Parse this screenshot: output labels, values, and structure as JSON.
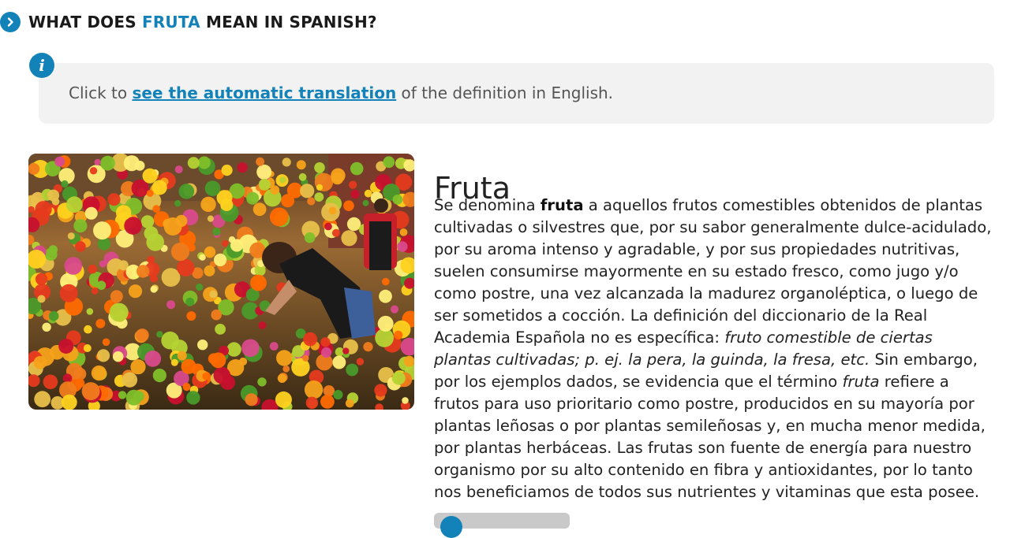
{
  "heading": {
    "prefix": "WHAT DOES ",
    "word": "FRUTA",
    "suffix": " MEAN IN SPANISH?"
  },
  "info": {
    "before": "Click to ",
    "link": "see the automatic translation",
    "after": " of the definition in English."
  },
  "definition": {
    "title": "Fruta",
    "lines": [
      {
        "parts": [
          {
            "t": "Se denomina "
          },
          {
            "b": "fruta"
          },
          {
            "t": " a aquellos frutos comestibles obtenidos de plantas"
          }
        ]
      },
      {
        "parts": [
          {
            "t": "cultivadas o silvestres que, por su sabor generalmente dulce-acidulado,"
          }
        ]
      },
      {
        "parts": [
          {
            "t": "por su aroma intenso y agradable, y por sus propiedades nutritivas,"
          }
        ]
      },
      {
        "parts": [
          {
            "t": "suelen consumirse mayormente en su estado fresco, como jugo y/o"
          }
        ]
      },
      {
        "parts": [
          {
            "t": "como postre, una vez alcanzada la madurez organoléptica, o luego de"
          }
        ]
      },
      {
        "parts": [
          {
            "t": "ser sometidos a cocción. La definición del diccionario de la Real"
          }
        ]
      },
      {
        "parts": [
          {
            "t": "Academia Española no es específica: "
          },
          {
            "i": "fruto comestible de ciertas"
          }
        ]
      },
      {
        "parts": [
          {
            "i": "plantas cultivadas; p. ej. la pera, la guinda, la fresa, etc."
          },
          {
            "t": " Sin embargo,"
          }
        ]
      },
      {
        "parts": [
          {
            "t": "por los ejemplos dados, se evidencia que el término "
          },
          {
            "i": "fruta"
          },
          {
            "t": " refiere a"
          }
        ]
      },
      {
        "parts": [
          {
            "t": "frutos para uso prioritario como postre, producidos en su mayoría por"
          }
        ]
      },
      {
        "parts": [
          {
            "t": "plantas leñosas o por plantas semileñosas y, en mucha menor medida,"
          }
        ]
      },
      {
        "parts": [
          {
            "t": "por plantas herbáceas. Las frutas son fuente de energía para nuestro"
          }
        ]
      },
      {
        "parts": [
          {
            "t": "organismo por su alto contenido en fibra y antioxidantes, por lo tanto"
          }
        ]
      },
      {
        "parts": [
          {
            "t": "nos beneficiamos de todos sus nutrientes y vitaminas que esta posee."
          }
        ]
      }
    ]
  },
  "photo": {
    "icon": "fruit-market-photo"
  },
  "colors": {
    "accent": "#1382b8",
    "info_bg": "#f2f2f2"
  }
}
